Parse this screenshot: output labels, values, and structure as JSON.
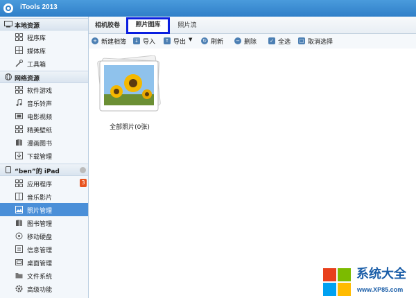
{
  "app": {
    "title": "iTools 2013"
  },
  "sidebar": {
    "sections": [
      {
        "label": "本地资源",
        "items": [
          "程序库",
          "媒体库",
          "工具箱"
        ]
      },
      {
        "label": "网络资源",
        "items": [
          "软件游戏",
          "音乐铃声",
          "电影视频",
          "精美壁纸",
          "漫画图书",
          "下载管理"
        ]
      },
      {
        "label": "“ben”的 iPad",
        "items": [
          "应用程序",
          "音乐影片",
          "照片管理",
          "图书管理",
          "移动硬盘",
          "信息管理",
          "桌面管理",
          "文件系统",
          "高级功能"
        ]
      }
    ],
    "apps_badge": "3",
    "active_item": "照片管理"
  },
  "tabs": [
    "相机胶卷",
    "照片图库",
    "照片流"
  ],
  "active_tab": "照片图库",
  "toolbar": {
    "new_album": "新建相簿",
    "import": "导入",
    "export": "导出",
    "refresh": "刷新",
    "delete": "删除",
    "select_all": "全选",
    "deselect": "取消选择"
  },
  "album": {
    "caption": "全部照片(0张)"
  },
  "watermark": {
    "text": "系统大全",
    "url": "www.XP85.com"
  },
  "colors": {
    "titlebar": "#3a8ad2",
    "active_item": "#4a8fd8",
    "tab_highlight": "#0a1ee0",
    "badge": "#e8521e"
  }
}
